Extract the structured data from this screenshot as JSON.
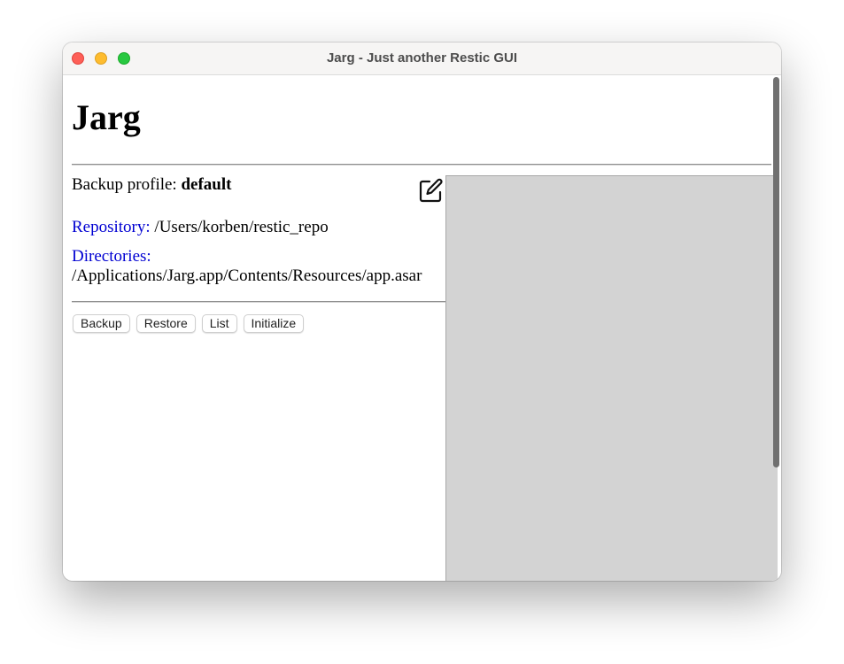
{
  "window": {
    "title": "Jarg - Just another Restic GUI"
  },
  "app": {
    "heading": "Jarg"
  },
  "profile": {
    "label": "Backup profile:",
    "name": "default"
  },
  "repository": {
    "label": "Repository:",
    "value": "/Users/korben/restic_repo"
  },
  "directories": {
    "label": "Directories:",
    "value": "/Applications/Jarg.app/Contents/Resources/app.asar"
  },
  "actions": {
    "backup": "Backup",
    "restore": "Restore",
    "list": "List",
    "initialize": "Initialize"
  },
  "icons": {
    "edit": "edit-icon",
    "traffic_close": "close-icon",
    "traffic_minimize": "minimize-icon",
    "traffic_zoom": "zoom-icon"
  },
  "colors": {
    "link": "#0000d2",
    "output_panel": "#d3d3d3",
    "close": "#fe5f57",
    "minimize": "#febc2e",
    "zoom": "#28c840"
  }
}
